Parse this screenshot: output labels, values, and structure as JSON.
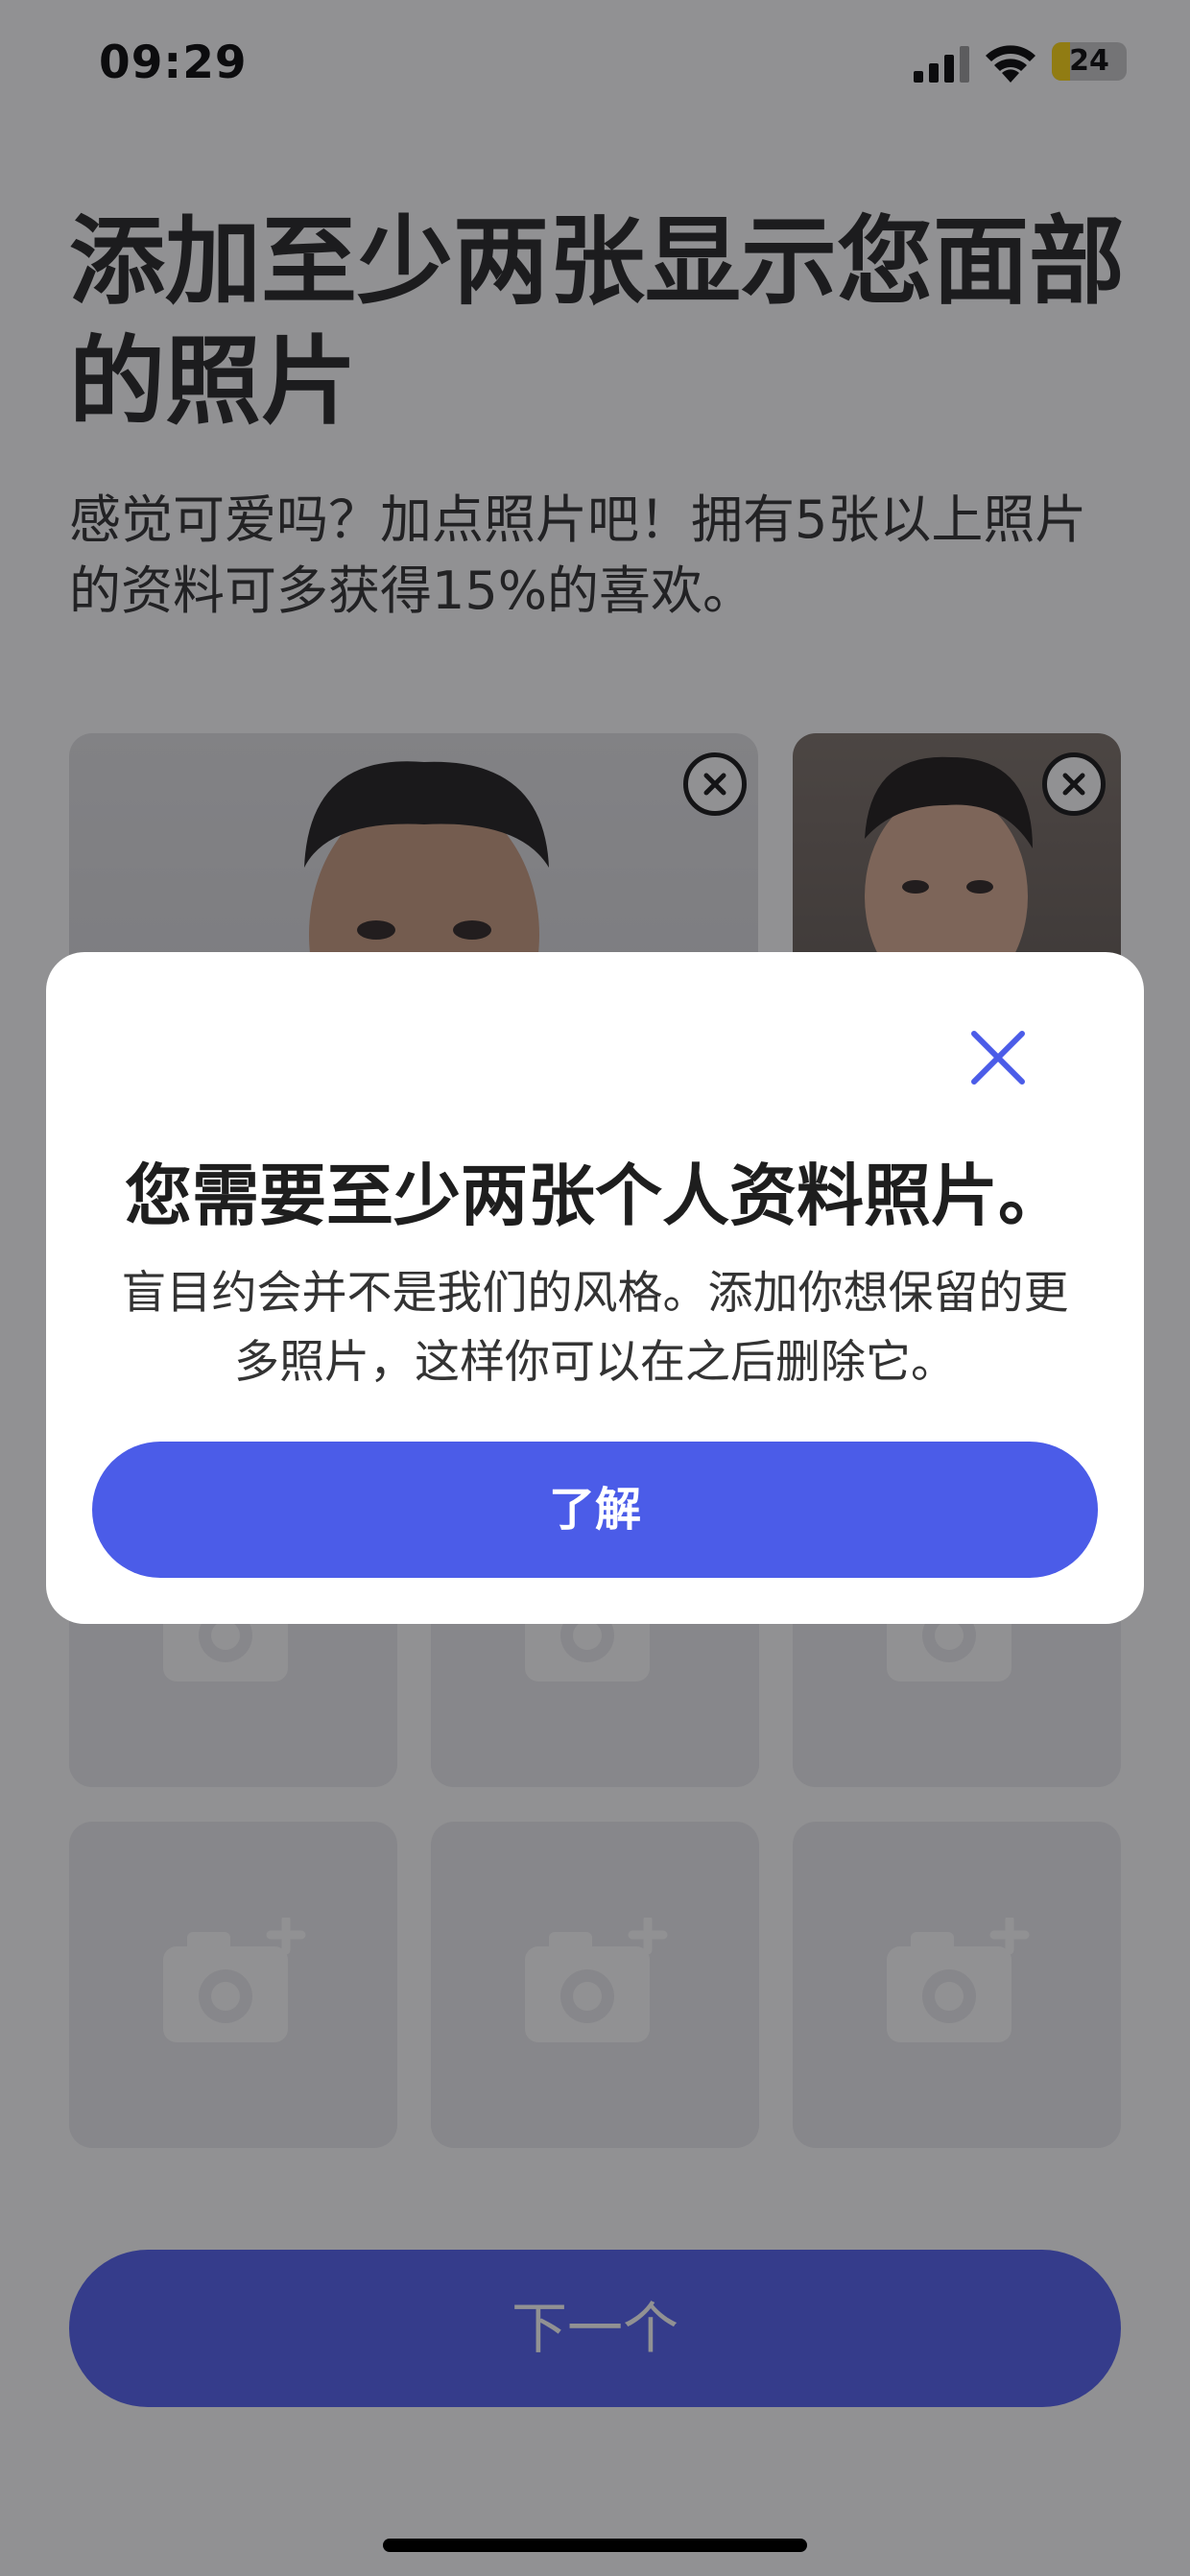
{
  "status_bar": {
    "time": "09:29",
    "battery_level": "24",
    "battery_fraction": 0.24,
    "icons": [
      "signal-icon",
      "wifi-icon",
      "battery-icon"
    ]
  },
  "page": {
    "title": "添加至少两张显示您面部的照片",
    "subtitle": "感觉可爱吗？加点照片吧！拥有5张以上照片的资料可多获得15%的喜欢。"
  },
  "photo_grid": {
    "uploaded_count": 2,
    "empty_slot_icon": "add-photo-camera-icon",
    "remove_icon": "close-icon"
  },
  "next_button_label": "下一个",
  "dialog": {
    "close_icon": "close-icon",
    "title": "您需要至少两张个人资料照片。",
    "body": "盲目约会并不是我们的风格。添加你想保留的更多照片，这样你可以在之后删除它。",
    "confirm_label": "了解"
  },
  "colors": {
    "accent": "#4b5ce8",
    "scrim": "#1a1a1e",
    "tile_background": "#ececef"
  }
}
